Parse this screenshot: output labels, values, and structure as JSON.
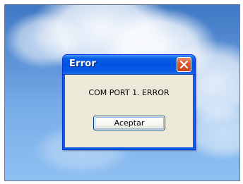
{
  "dialog": {
    "title": "Error",
    "message": "COM PORT 1. ERROR",
    "ok_label": "Aceptar"
  },
  "colors": {
    "title_bar": "#0054e3",
    "close_button": "#d9552c",
    "dialog_body": "#ece9d8",
    "sky": "#5b91d6"
  },
  "icons": {
    "close": "close-icon"
  }
}
